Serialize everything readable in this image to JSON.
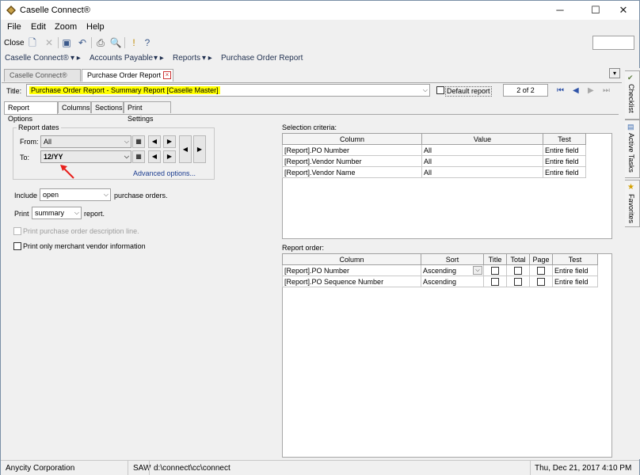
{
  "window": {
    "title": "Caselle Connect®",
    "minimize": "─",
    "maximize": "☐",
    "close": "✕"
  },
  "menu": [
    "File",
    "Edit",
    "Zoom",
    "Help"
  ],
  "toolbar": {
    "close_label": "Close"
  },
  "breadcrumb": [
    "Caselle Connect®",
    "Accounts Payable",
    "Reports",
    "Purchase Order Report"
  ],
  "doc_tabs": [
    "Caselle Connect®",
    "Purchase Order Report"
  ],
  "report": {
    "title_label": "Title:",
    "title_value": "Purchase Order Report - Summary Report [Caselle Master]",
    "default_report_label": "Default report",
    "page_indicator": "2 of 2"
  },
  "sub_tabs": [
    "Report Options",
    "Columns",
    "Sections",
    "Print Settings"
  ],
  "report_dates": {
    "legend": "Report dates",
    "from_label": "From:",
    "from_value": "All",
    "to_label": "To:",
    "to_value": "12/YY",
    "advanced": "Advanced options..."
  },
  "include": {
    "label": "Include",
    "value": "open",
    "suffix": "purchase orders."
  },
  "print": {
    "label": "Print",
    "value": "summary",
    "suffix": "report."
  },
  "options": {
    "description_line": "Print purchase order description line.",
    "merchant_only": "Print only merchant vendor information"
  },
  "selection_criteria": {
    "label": "Selection criteria:",
    "headers": [
      "Column",
      "Value",
      "Test"
    ],
    "rows": [
      [
        "[Report].PO Number",
        "All",
        "Entire field"
      ],
      [
        "[Report].Vendor Number",
        "All",
        "Entire field"
      ],
      [
        "[Report].Vendor Name",
        "All",
        "Entire field"
      ]
    ]
  },
  "report_order": {
    "label": "Report order:",
    "headers": [
      "Column",
      "Sort",
      "Title",
      "Total",
      "Page",
      "Test"
    ],
    "rows": [
      [
        "[Report].PO Number",
        "Ascending",
        "Entire field"
      ],
      [
        "[Report].PO Sequence Number",
        "Ascending",
        "Entire field"
      ]
    ]
  },
  "side_tabs": [
    "Checklist",
    "Active Tasks",
    "Favorites"
  ],
  "status": {
    "org": "Anycity Corporation",
    "user": "SAW",
    "path": "d:\\connect\\cc\\connect",
    "datetime": "Thu, Dec 21, 2017 4:10 PM"
  },
  "colors": {
    "highlight": "#ffff00",
    "arrow": "#e8201c",
    "link": "#1a3b8f"
  }
}
